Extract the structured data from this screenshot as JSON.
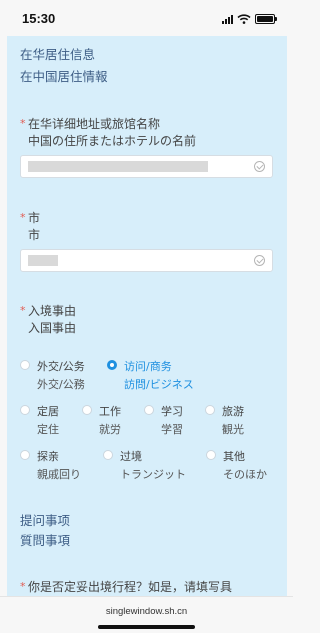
{
  "status": {
    "time": "15:30"
  },
  "section": {
    "title_zh": "在华居住信息",
    "title_ja": "在中国居住情報"
  },
  "address": {
    "required_mark": "*",
    "label_zh": "在华详细地址或旅馆名称",
    "label_ja": "中国の住所またはホテルの名前"
  },
  "city": {
    "required_mark": "*",
    "label_zh": "市",
    "label_ja": "市"
  },
  "entry_purpose": {
    "required_mark": "*",
    "label_zh": "入境事由",
    "label_ja": "入国事由",
    "selected": "访问/商务",
    "options": [
      {
        "zh": "外交/公务",
        "ja": "外交/公務"
      },
      {
        "zh": "访问/商务",
        "ja": "訪問/ビジネス"
      },
      {
        "zh": "定居",
        "ja": "定住"
      },
      {
        "zh": "工作",
        "ja": "就労"
      },
      {
        "zh": "学习",
        "ja": "学習"
      },
      {
        "zh": "旅游",
        "ja": "観光"
      },
      {
        "zh": "探亲",
        "ja": "親戚回り"
      },
      {
        "zh": "过境",
        "ja": "トランジット"
      },
      {
        "zh": "其他",
        "ja": "そのほか"
      }
    ]
  },
  "questions": {
    "title_zh": "提问事项",
    "title_ja": "質問事項",
    "q1_required_mark": "*",
    "q1_text": "你是否定妥出境行程？如是，请填写具"
  },
  "browser": {
    "url": "singlewindow.sh.cn"
  },
  "colors": {
    "panel": "#d7eefa",
    "accent": "#1e90e0",
    "required": "#e25b52",
    "heading": "#3d5d85"
  }
}
